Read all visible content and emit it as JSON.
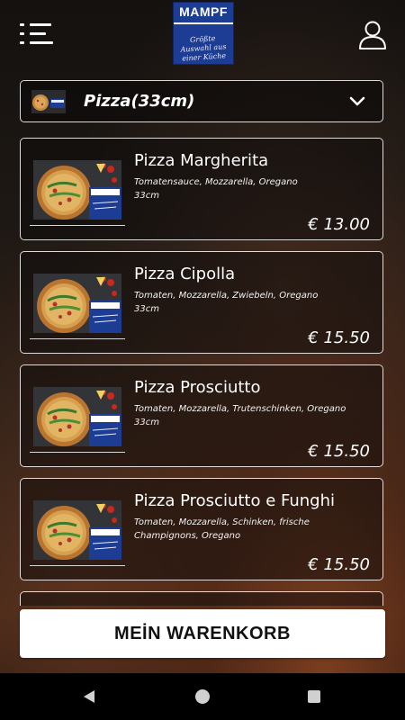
{
  "header": {
    "logo_brand": "MAMPF",
    "logo_tagline": "Größte Auswahl aus einer Küche"
  },
  "category": {
    "selected_label": "Pizza(33cm)"
  },
  "products": [
    {
      "name": "Pizza Margherita",
      "description": "Tomatensauce, Mozzarella, Oregano",
      "size": "33cm",
      "price": "€ 13.00"
    },
    {
      "name": "Pizza Cipolla",
      "description": "Tomaten, Mozzarella, Zwiebeln, Oregano",
      "size": "33cm",
      "price": "€ 15.50"
    },
    {
      "name": "Pizza Prosciutto",
      "description": "Tomaten, Mozzarella, Trutenschinken, Oregano",
      "size": "33cm",
      "price": "€ 15.50"
    },
    {
      "name": "Pizza Prosciutto e Funghi",
      "description": "Tomaten, Mozzarella, Schinken, frische Champignons, Oregano",
      "size": "",
      "price": "€ 15.50"
    }
  ],
  "cart_button": {
    "label": "MEİN WARENKORB"
  },
  "icons": {
    "menu": "menu-icon",
    "user": "user-icon",
    "chevron": "chevron-down-icon",
    "nav_back": "back-triangle-icon",
    "nav_home": "home-circle-icon",
    "nav_recent": "recent-apps-square-icon"
  },
  "colors": {
    "logo_blue": "#1d3c93",
    "button_bg": "#ffffff",
    "navbar_bg": "#000000"
  }
}
